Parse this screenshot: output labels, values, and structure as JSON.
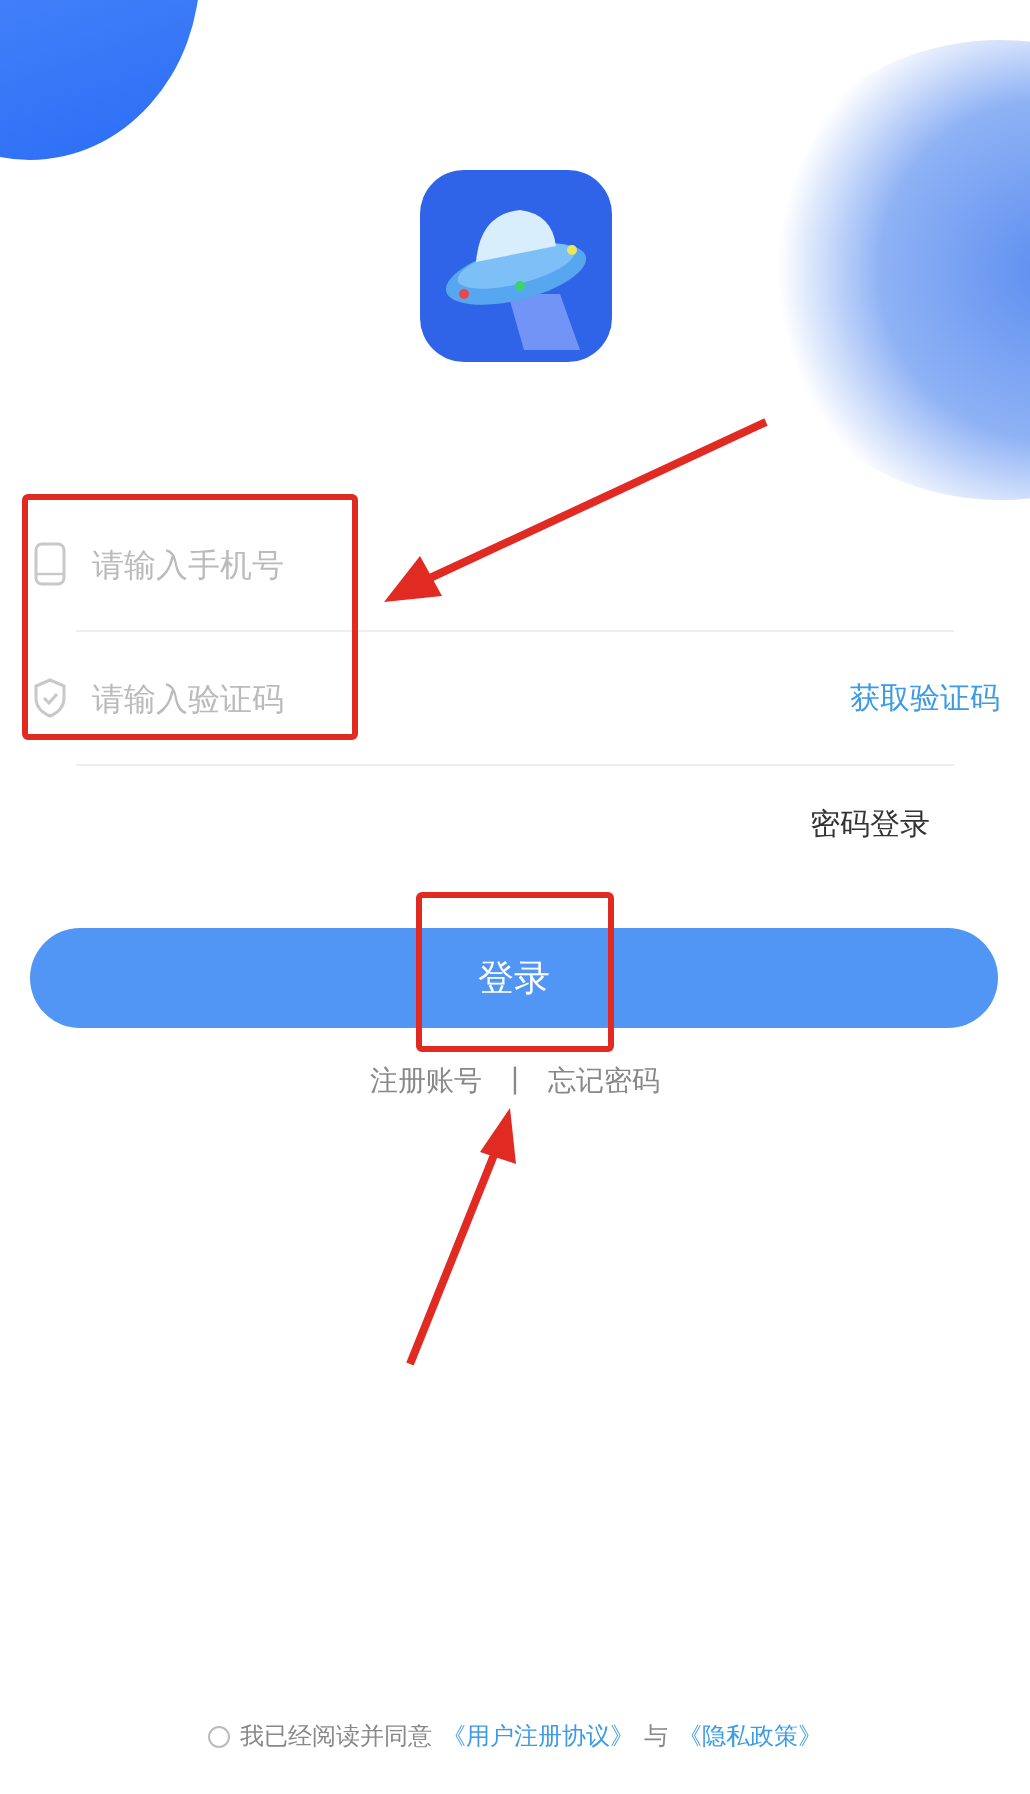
{
  "phone_field": {
    "placeholder": "请输入手机号"
  },
  "code_field": {
    "placeholder": "请输入验证码"
  },
  "get_code_link": "获取验证码",
  "password_login_link": "密码登录",
  "login_button": "登录",
  "register_link": "注册账号",
  "links_separator": "|",
  "forgot_password_link": "忘记密码",
  "agreement": {
    "checked": false,
    "text": "我已经阅读并同意",
    "user_agreement_link": "《用户注册协议》",
    "conjunction": "与",
    "privacy_link": "《隐私政策》"
  }
}
